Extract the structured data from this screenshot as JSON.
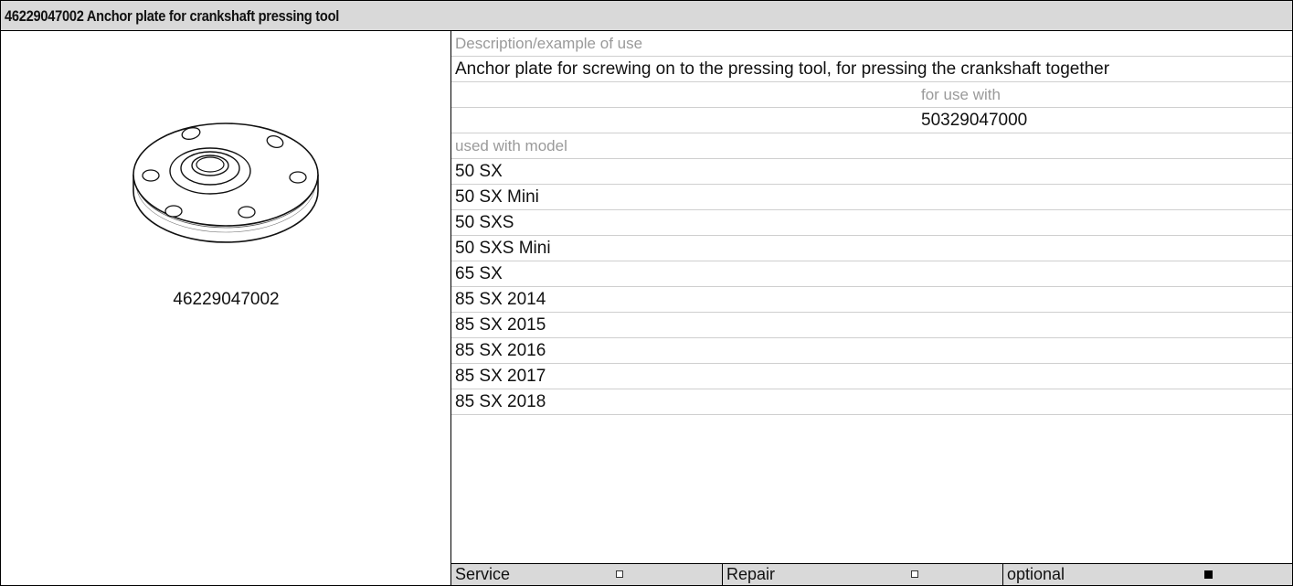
{
  "header": {
    "title": "46229047002 Anchor plate for crankshaft pressing tool"
  },
  "image_panel": {
    "part_number": "46229047002",
    "drawing_icon": "anchor-plate-drawing"
  },
  "details": {
    "description_label": "Description/example of use",
    "description_text": "Anchor plate for screwing on to the pressing tool, for pressing the crankshaft together",
    "for_use_with_label": "for use with",
    "for_use_with_value": "50329047000",
    "models_label": "used with model",
    "models": [
      "50 SX",
      "50 SX Mini",
      "50 SXS",
      "50 SXS Mini",
      "65 SX",
      "85 SX 2014",
      "85 SX 2015",
      "85 SX 2016",
      "85 SX 2017",
      "85 SX 2018"
    ]
  },
  "legend": {
    "service_label": "Service",
    "service_checked": false,
    "repair_label": "Repair",
    "repair_checked": false,
    "optional_label": "optional",
    "optional_checked": true
  }
}
